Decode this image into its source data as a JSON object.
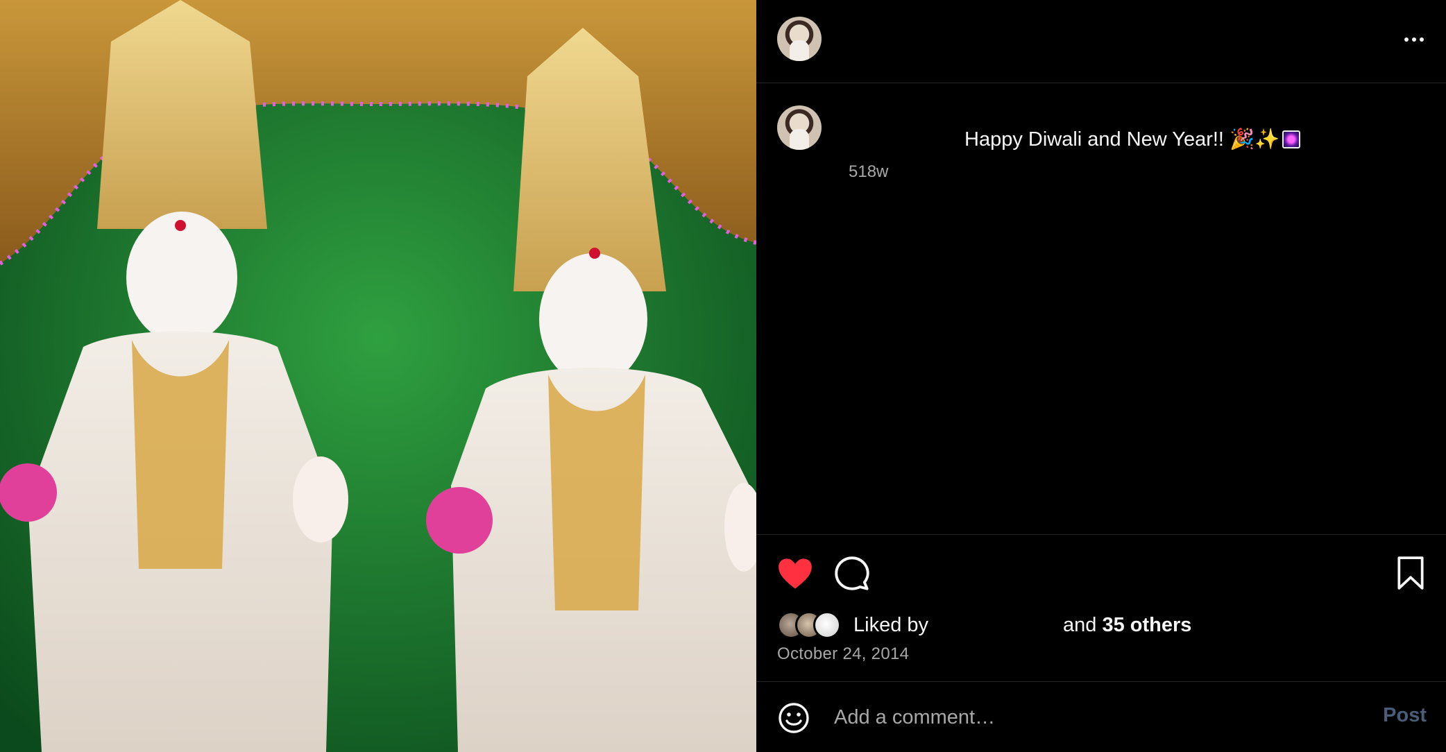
{
  "header": {
    "avatar_icon": "user-avatar",
    "more_icon": "more-horizontal-icon"
  },
  "caption": {
    "text": "Happy Diwali and New Year!! 🎉✨",
    "time_ago": "518w"
  },
  "actions": {
    "like_icon": "heart-filled-icon",
    "comment_icon": "comment-icon",
    "save_icon": "bookmark-icon",
    "like_color": "#ff3040"
  },
  "likes": {
    "prefix": "Liked by",
    "and": "and",
    "others": "35 others"
  },
  "date": "October 24, 2014",
  "comment_bar": {
    "emoji_icon": "emoji-smile-icon",
    "placeholder": "Add a comment…",
    "post_label": "Post",
    "post_color": "#4a5d78"
  }
}
